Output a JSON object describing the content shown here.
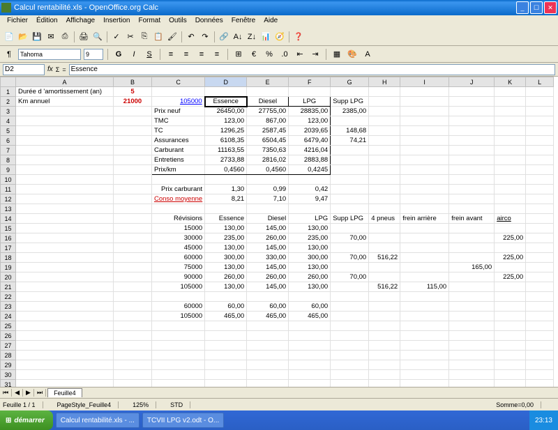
{
  "window": {
    "title": "Calcul rentabilité.xls - OpenOffice.org Calc"
  },
  "menu": [
    "Fichier",
    "Édition",
    "Affichage",
    "Insertion",
    "Format",
    "Outils",
    "Données",
    "Fenêtre",
    "Aide"
  ],
  "font": {
    "name": "Tahoma",
    "size": "9"
  },
  "cellref": "D2",
  "formula": "Essence",
  "cols": [
    "",
    "A",
    "B",
    "C",
    "D",
    "E",
    "F",
    "G",
    "H",
    "I",
    "J",
    "K",
    "L"
  ],
  "r1": {
    "a": "Durée d 'amortissement (an)",
    "b": "5"
  },
  "r2": {
    "a": "Km annuel",
    "b": "21000",
    "c": "105000",
    "d": "Essence",
    "e": "Diesel",
    "f": "LPG",
    "g": "Supp LPG"
  },
  "r3": {
    "c": "Prix neuf",
    "d": "26450,00",
    "e": "27755,00",
    "f": "28835,00",
    "g": "2385,00"
  },
  "r4": {
    "c": "TMC",
    "d": "123,00",
    "e": "867,00",
    "f": "123,00"
  },
  "r5": {
    "c": "TC",
    "d": "1296,25",
    "e": "2587,45",
    "f": "2039,65",
    "g": "148,68"
  },
  "r6": {
    "c": "Assurances",
    "d": "6108,35",
    "e": "6504,45",
    "f": "6479,40",
    "g": "74,21"
  },
  "r7": {
    "c": "Carburant",
    "d": "11163,55",
    "e": "7350,63",
    "f": "4216,04"
  },
  "r8": {
    "c": "Entretiens",
    "d": "2733,88",
    "e": "2816,02",
    "f": "2883,88"
  },
  "r9": {
    "c": "Prix/km",
    "d": "0,4560",
    "e": "0,4560",
    "f": "0,4245"
  },
  "r11": {
    "c": "Prix carburant",
    "d": "1,30",
    "e": "0,99",
    "f": "0,42"
  },
  "r12": {
    "c": "Conso moyenne",
    "d": "8,21",
    "e": "7,10",
    "f": "9,47"
  },
  "r14": {
    "c": "Révisions",
    "d": "Essence",
    "e": "Diesel",
    "f": "LPG",
    "g": "Supp LPG",
    "h": "4 pneus",
    "i": "frein arrière",
    "j": "frein avant",
    "k": "airco"
  },
  "rev": [
    {
      "c": "15000",
      "d": "130,00",
      "e": "145,00",
      "f": "130,00"
    },
    {
      "c": "30000",
      "d": "235,00",
      "e": "260,00",
      "f": "235,00",
      "g": "70,00",
      "k": "225,00"
    },
    {
      "c": "45000",
      "d": "130,00",
      "e": "145,00",
      "f": "130,00"
    },
    {
      "c": "60000",
      "d": "300,00",
      "e": "330,00",
      "f": "300,00",
      "g": "70,00",
      "h": "516,22",
      "k": "225,00"
    },
    {
      "c": "75000",
      "d": "130,00",
      "e": "145,00",
      "f": "130,00",
      "j": "165,00"
    },
    {
      "c": "90000",
      "d": "260,00",
      "e": "260,00",
      "f": "260,00",
      "g": "70,00",
      "k": "225,00"
    },
    {
      "c": "105000",
      "d": "130,00",
      "e": "145,00",
      "f": "130,00",
      "h": "516,22",
      "i": "115,00"
    }
  ],
  "tot": [
    {
      "c": "60000",
      "d": "60,00",
      "e": "60,00",
      "f": "60,00"
    },
    {
      "c": "105000",
      "d": "465,00",
      "e": "465,00",
      "f": "465,00"
    }
  ],
  "sheet": "Feuille4",
  "status": {
    "pos": "Feuille 1 / 1",
    "style": "PageStyle_Feuille4",
    "zoom": "125%",
    "std": "STD",
    "sum": "Somme=0,00"
  },
  "taskbar": {
    "start": "démarrer",
    "apps": [
      "Calcul rentabilité.xls - ...",
      "TCVII LPG v2.odt - O..."
    ],
    "time": "23:13"
  },
  "chart_data": {
    "type": "table",
    "title": "Calcul rentabilité",
    "amortissement_an": 5,
    "km_annuel": 21000,
    "km_total": 105000,
    "cost_breakdown": {
      "columns": [
        "Essence",
        "Diesel",
        "LPG",
        "Supp LPG"
      ],
      "rows": [
        {
          "label": "Prix neuf",
          "values": [
            26450.0,
            27755.0,
            28835.0,
            2385.0
          ]
        },
        {
          "label": "TMC",
          "values": [
            123.0,
            867.0,
            123.0,
            null
          ]
        },
        {
          "label": "TC",
          "values": [
            1296.25,
            2587.45,
            2039.65,
            148.68
          ]
        },
        {
          "label": "Assurances",
          "values": [
            6108.35,
            6504.45,
            6479.4,
            74.21
          ]
        },
        {
          "label": "Carburant",
          "values": [
            11163.55,
            7350.63,
            4216.04,
            null
          ]
        },
        {
          "label": "Entretiens",
          "values": [
            2733.88,
            2816.02,
            2883.88,
            null
          ]
        },
        {
          "label": "Prix/km",
          "values": [
            0.456,
            0.456,
            0.4245,
            null
          ]
        }
      ]
    },
    "fuel": {
      "prix_carburant": [
        1.3,
        0.99,
        0.42
      ],
      "conso_moyenne": [
        8.21,
        7.1,
        9.47
      ]
    },
    "revisions": {
      "columns": [
        "Révisions",
        "Essence",
        "Diesel",
        "LPG",
        "Supp LPG",
        "4 pneus",
        "frein arrière",
        "frein avant",
        "airco"
      ],
      "data": [
        [
          15000,
          130,
          145,
          130,
          null,
          null,
          null,
          null,
          null
        ],
        [
          30000,
          235,
          260,
          235,
          70,
          null,
          null,
          null,
          225
        ],
        [
          45000,
          130,
          145,
          130,
          null,
          null,
          null,
          null,
          null
        ],
        [
          60000,
          300,
          330,
          300,
          70,
          516.22,
          null,
          null,
          225
        ],
        [
          75000,
          130,
          145,
          130,
          null,
          null,
          null,
          165,
          null
        ],
        [
          90000,
          260,
          260,
          260,
          70,
          null,
          null,
          null,
          225
        ],
        [
          105000,
          130,
          145,
          130,
          null,
          516.22,
          115,
          null,
          null
        ]
      ],
      "totals": [
        [
          60000,
          60,
          60,
          60
        ],
        [
          105000,
          465,
          465,
          465
        ]
      ]
    }
  }
}
